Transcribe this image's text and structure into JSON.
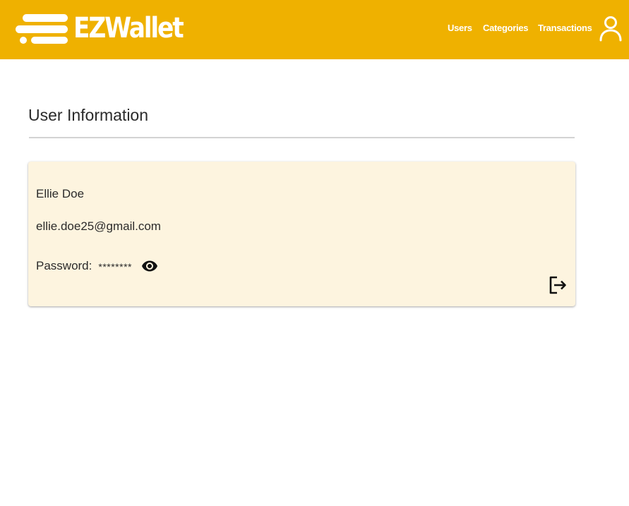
{
  "header": {
    "brand": "EZWallet",
    "bg_color": "#efb100",
    "nav": {
      "users": "Users",
      "categories": "Categories",
      "transactions": "Transactions"
    },
    "account_icon": "person-icon"
  },
  "main": {
    "title": "User Information",
    "card": {
      "name": "Ellie Doe",
      "email": "ellie.doe25@gmail.com",
      "password_label": "Password:",
      "password_mask": "********",
      "toggle_icon": "eye-icon",
      "logout_icon": "logout-icon",
      "bg_color": "#fdf4df"
    }
  }
}
